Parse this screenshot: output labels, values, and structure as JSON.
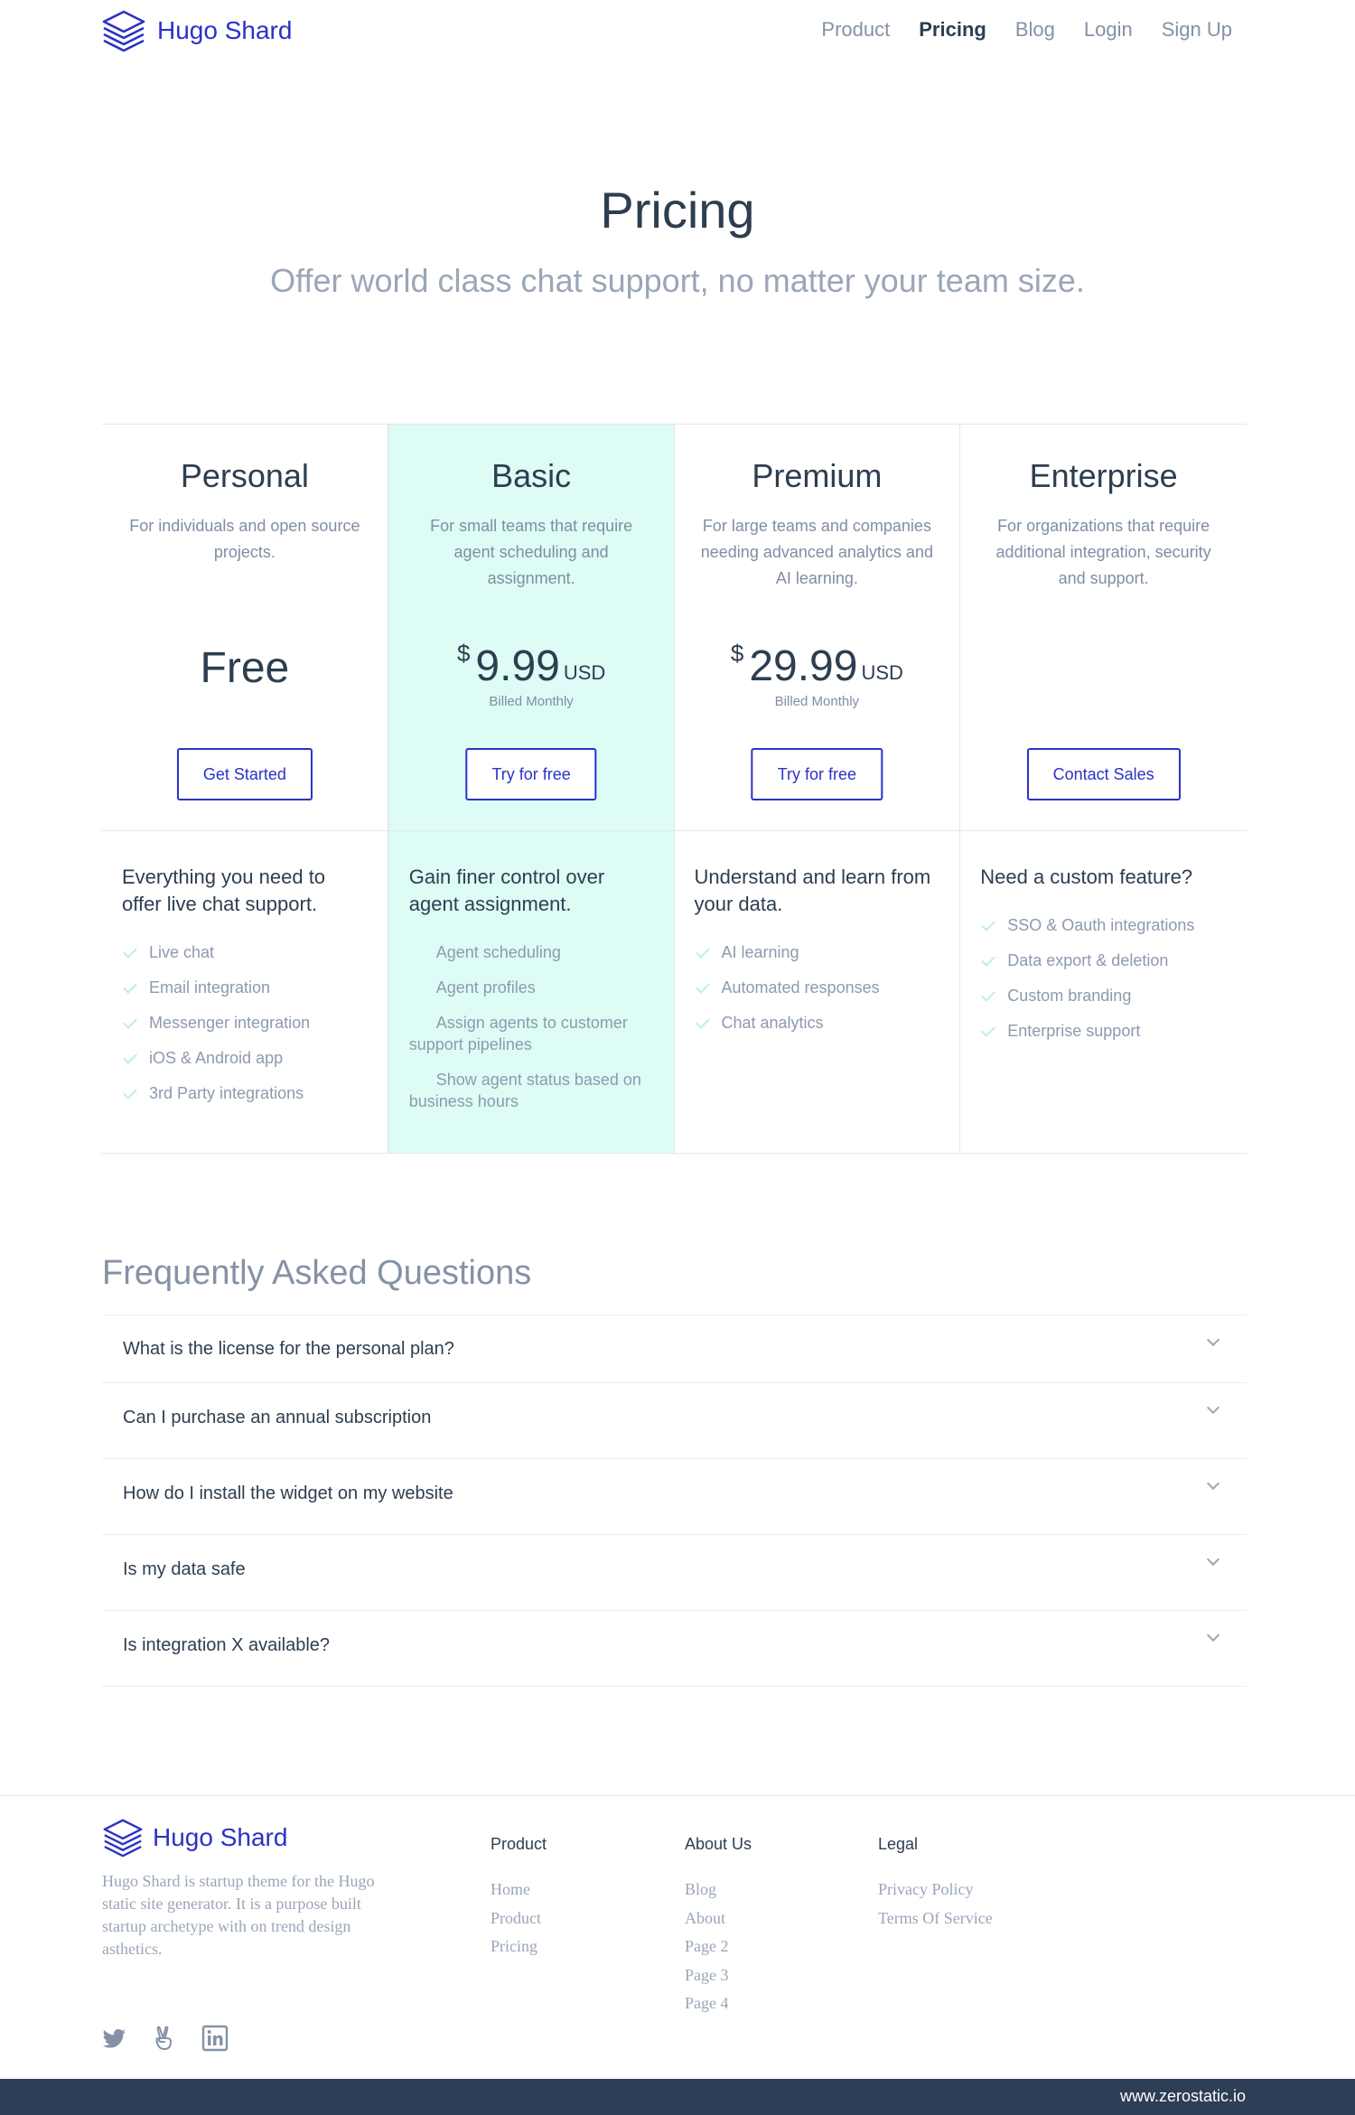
{
  "header": {
    "brand": "Hugo Shard",
    "nav": [
      {
        "label": "Product",
        "active": false
      },
      {
        "label": "Pricing",
        "active": true
      },
      {
        "label": "Blog",
        "active": false
      },
      {
        "label": "Login",
        "active": false
      },
      {
        "label": "Sign Up",
        "active": false
      }
    ]
  },
  "hero": {
    "title": "Pricing",
    "subtitle": "Offer world class chat support, no matter your team size."
  },
  "plans": [
    {
      "name": "Personal",
      "description": "For individuals and open source projects.",
      "price_text": "Free",
      "button": "Get Started",
      "features_heading": "Everything you need to offer live chat support.",
      "features": [
        "Live chat",
        "Email integration",
        "Messenger integration",
        "iOS & Android app",
        "3rd Party integrations"
      ]
    },
    {
      "name": "Basic",
      "description": "For small teams that require agent scheduling and assignment.",
      "currency": "$",
      "amount": "9.99",
      "unit": "USD",
      "billed": "Billed Monthly",
      "button": "Try for free",
      "features_heading": "Gain finer control over agent assignment.",
      "features": [
        "Agent scheduling",
        "Agent profiles",
        "Assign agents to customer support pipelines",
        "Show agent status based on business hours"
      ]
    },
    {
      "name": "Premium",
      "description": "For large teams and companies needing advanced analytics and AI learning.",
      "currency": "$",
      "amount": "29.99",
      "unit": "USD",
      "billed": "Billed Monthly",
      "button": "Try for free",
      "features_heading": "Understand and learn from your data.",
      "features": [
        "AI learning",
        "Automated responses",
        "Chat analytics"
      ]
    },
    {
      "name": "Enterprise",
      "description": "For organizations that require additional integration, security and support.",
      "button": "Contact Sales",
      "features_heading": "Need a custom feature?",
      "features": [
        "SSO & Oauth integrations",
        "Data export & deletion",
        "Custom branding",
        "Enterprise support"
      ]
    }
  ],
  "faq": {
    "title": "Frequently Asked Questions",
    "items": [
      "What is the license for the personal plan?",
      "Can I purchase an annual subscription",
      "How do I install the widget on my website",
      "Is my data safe",
      "Is integration X available?"
    ]
  },
  "footer": {
    "brand": "Hugo Shard",
    "description": "Hugo Shard is startup theme for the Hugo static site generator. It is a purpose built startup archetype with on trend design asthetics.",
    "columns": [
      {
        "title": "Product",
        "links": [
          "Home",
          "Product",
          "Pricing"
        ]
      },
      {
        "title": "About Us",
        "links": [
          "Blog",
          "About",
          "Page 2",
          "Page 3",
          "Page 4"
        ]
      },
      {
        "title": "Legal",
        "links": [
          "Privacy Policy",
          "Terms Of Service"
        ]
      }
    ],
    "social": [
      "twitter-icon",
      "angellist-icon",
      "linkedin-icon"
    ],
    "site": "www.zerostatic.io"
  },
  "colors": {
    "accent": "#2b32c4",
    "featured_bg": "#dcfcf5",
    "text_dark": "#2d3e50",
    "text_muted": "#8d9aad",
    "bottom_bar": "#2d3e57"
  }
}
